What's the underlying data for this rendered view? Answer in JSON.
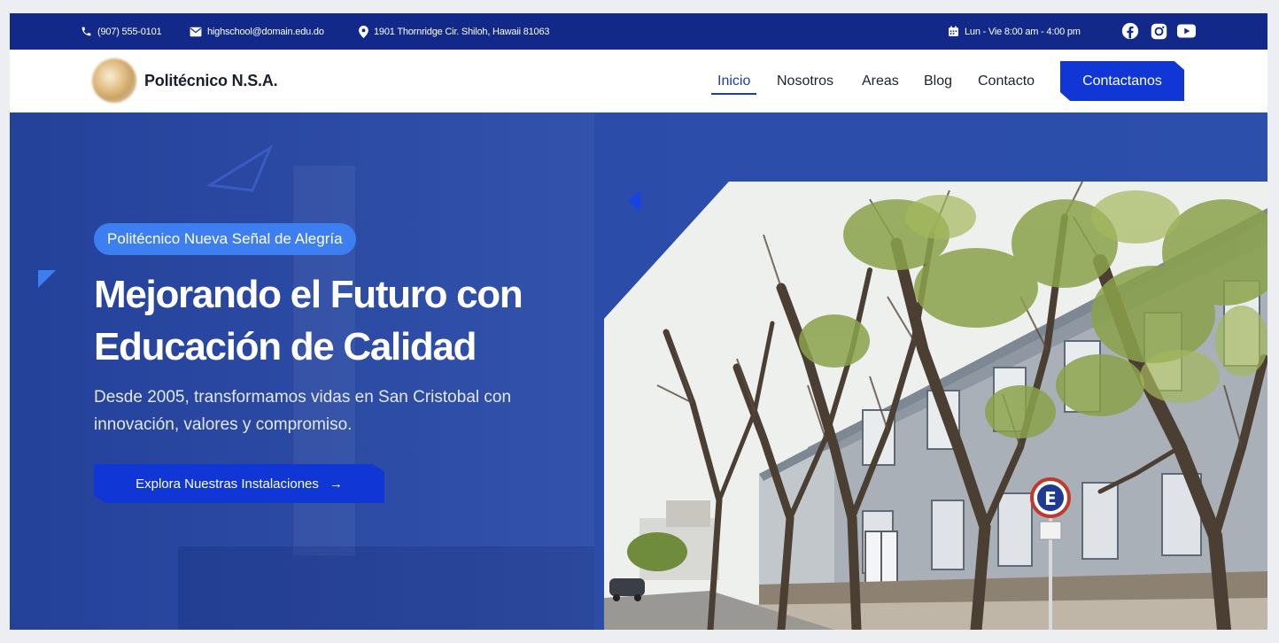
{
  "topbar": {
    "phone": "(907) 555-0101",
    "email": "highschool@domain.edu.do",
    "address": "1901 Thornridge Cir. Shiloh, Hawaii 81063",
    "hours": "Lun - Vie 8:00 am - 4:00 pm",
    "social": [
      "facebook-icon",
      "instagram-icon",
      "youtube-icon"
    ]
  },
  "nav": {
    "brand": "Politécnico N.S.A.",
    "links": [
      {
        "label": "Inicio",
        "active": true
      },
      {
        "label": "Nosotros"
      },
      {
        "label": "Areas"
      },
      {
        "label": "Blog"
      },
      {
        "label": "Contacto"
      }
    ],
    "cta": "Contactanos"
  },
  "hero": {
    "badge": "Politécnico Nueva Señal de Alegría",
    "title_line1": "Mejorando el Futuro con",
    "title_line2": "Educación de Calidad",
    "subtitle_line1": "Desde 2005, transformamos vidas en San Cristobal con",
    "subtitle_line2": "innovación, valores y compromiso.",
    "cta": "Explora Nuestras Instalaciones",
    "cta_arrow": "→",
    "sign_letter": "E"
  },
  "colors": {
    "topbar_bg": "#12298a",
    "hero_bg": "#2b4ca8",
    "accent": "#1036d6",
    "badge": "#3d7ef0",
    "active_link": "#1a3db3"
  }
}
